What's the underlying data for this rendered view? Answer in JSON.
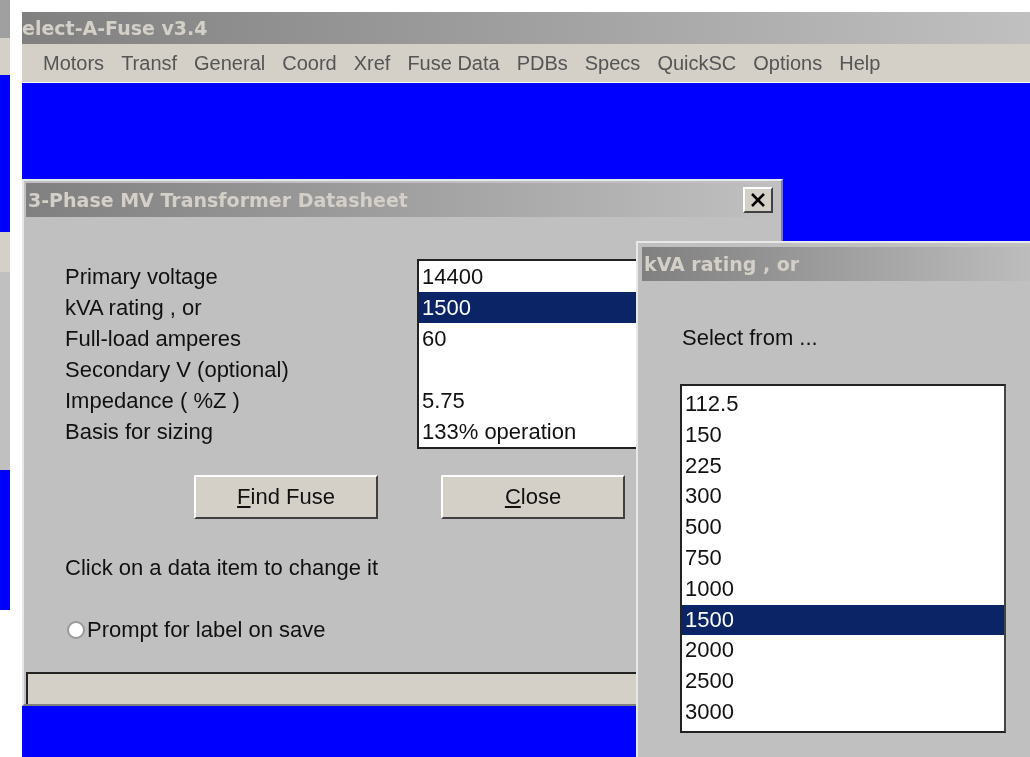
{
  "app_window": {
    "title": "elect-A-Fuse v3.4",
    "menu": [
      "Motors",
      "Transf",
      "General",
      "Coord",
      "Xref",
      "Fuse Data",
      "PDBs",
      "Specs",
      "QuickSC",
      "Options",
      "Help"
    ]
  },
  "dialog": {
    "title": "3-Phase MV Transformer Datasheet",
    "fields": [
      {
        "label": "Primary voltage",
        "value": "14400",
        "selected": false
      },
      {
        "label": "kVA rating , or",
        "value": "1500",
        "selected": true
      },
      {
        "label": "Full-load amperes",
        "value": "60",
        "selected": false
      },
      {
        "label": "Secondary V (optional)",
        "selected": false
      },
      {
        "label": "Impedance ( %Z )",
        "value": "5.75",
        "selected": false
      },
      {
        "label": "Basis for sizing",
        "value": "133% operation",
        "selected": false
      }
    ],
    "buttons": [
      {
        "accesskey": "F",
        "label": "ind Fuse"
      },
      {
        "accesskey": "C",
        "label": "lose"
      }
    ],
    "hint": "Click on a data item to change it",
    "radio": {
      "label": "Prompt for label on save",
      "selected": false
    }
  },
  "popup": {
    "title": "kVA rating , or",
    "prompt": "Select from ...",
    "options": [
      {
        "label": "112.5",
        "selected": false
      },
      {
        "label": "150",
        "selected": false
      },
      {
        "label": "225",
        "selected": false
      },
      {
        "label": "300",
        "selected": false
      },
      {
        "label": "500",
        "selected": false
      },
      {
        "label": "750",
        "selected": false
      },
      {
        "label": "1000",
        "selected": false
      },
      {
        "label": "1500",
        "selected": true
      },
      {
        "label": "2000",
        "selected": false
      },
      {
        "label": "2500",
        "selected": false
      },
      {
        "label": "3000",
        "selected": false
      }
    ]
  }
}
